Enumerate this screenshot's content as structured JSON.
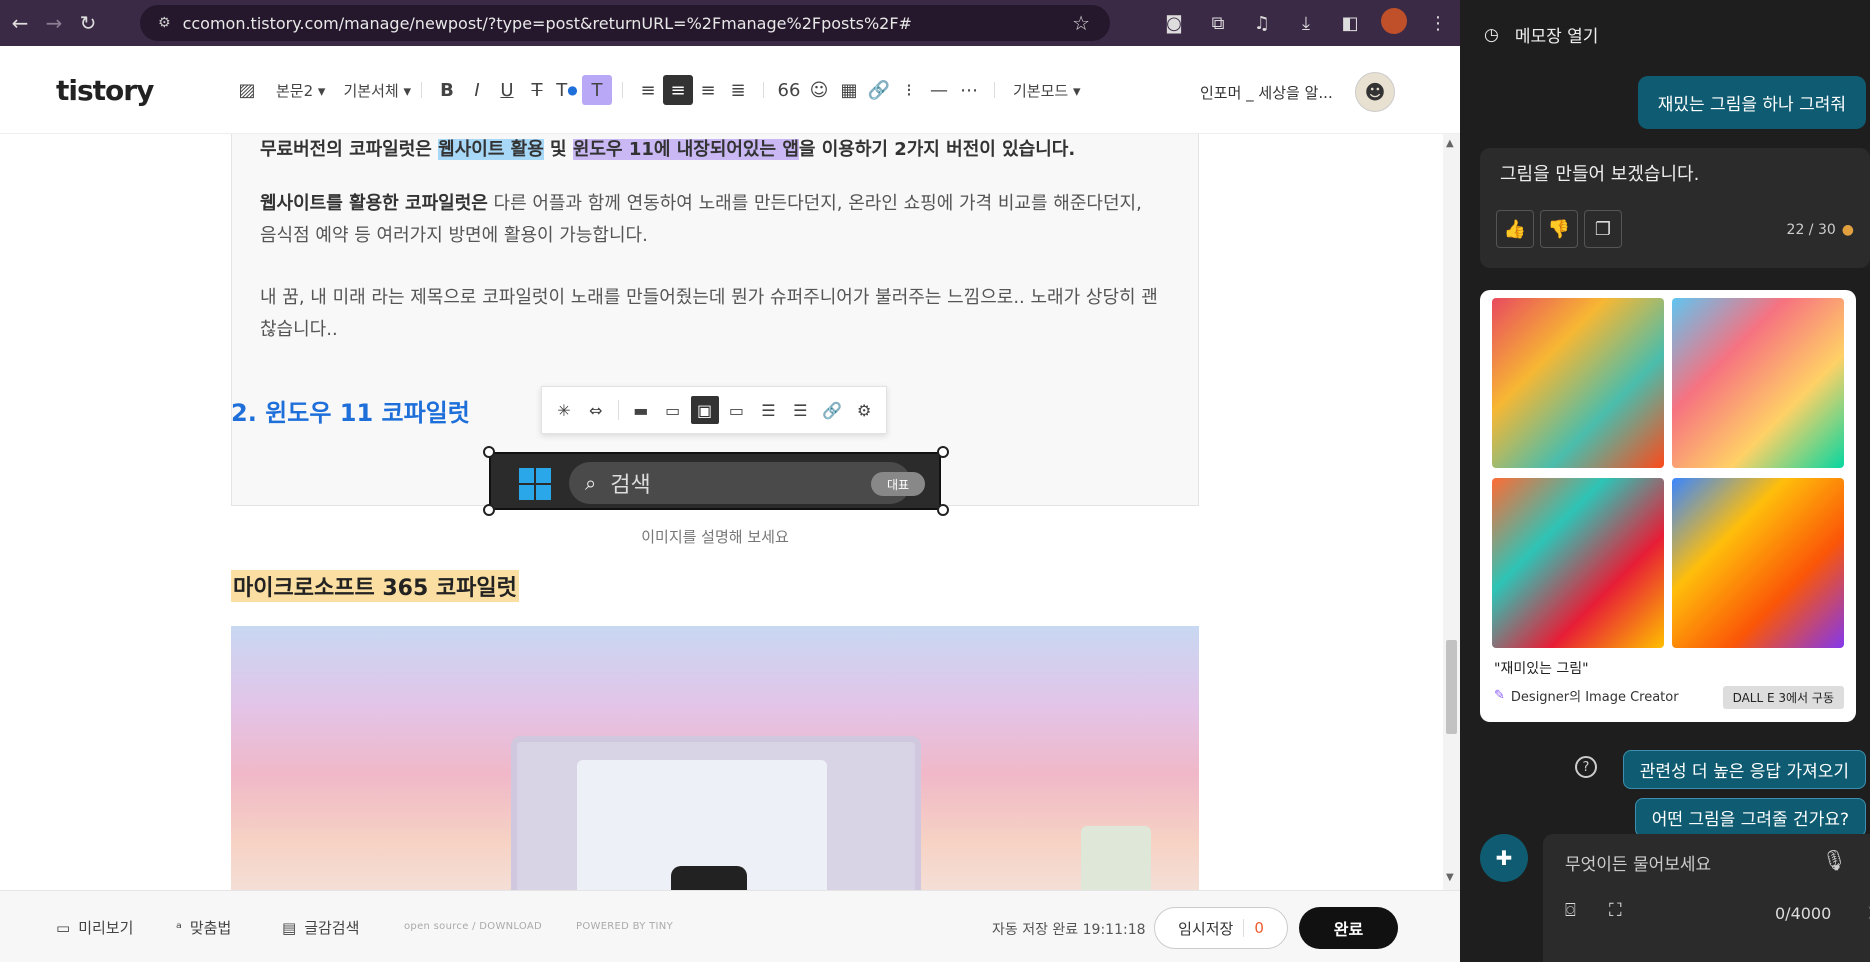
{
  "browser": {
    "url": "ccomon.tistory.com/manage/newpost/?type=post&returnURL=%2Fmanage%2Fposts%2F#"
  },
  "editor": {
    "logo": "tistory",
    "toolbar": {
      "paragraph_style": "본문2",
      "font": "기본서체",
      "mode": "기본모드"
    },
    "blog_name": "인포머 _ 세상을 알..."
  },
  "content": {
    "para1_part1": "무료버전의 코파일럿은 ",
    "para1_hl1": "웹사이트 활용",
    "para1_mid": " 및 ",
    "para1_hl2": "윈도우 11에 내장되어있는 앱",
    "para1_part2": "을 이용하기 2가지 버전이 있습니다.",
    "para2_bold": "웹사이트를 활용한 코파일럿은",
    "para2_rest": " 다른 어플과 함께 연동하여 노래를 만든다던지, 온라인 쇼핑에 가격 비교를 해준다던지, 음식점 예약 등 여러가지 방면에 활용이 가능합니다.",
    "para3": "내 꿈, 내 미래 라는 제목으로 코파일럿이 노래를 만들어줬는데 뭔가 슈퍼주니어가 불러주는 느낌으로.. 노래가 상당히 괜찮습니다..",
    "heading_copilot": "2. 윈도우 11 코파일럿",
    "taskbar_search": "검색",
    "taskbar_badge": "대표",
    "image_caption": "이미지를 설명해 보세요",
    "heading_m365": "마이크로소프트 365 코파일럿"
  },
  "bottom_bar": {
    "preview": "미리보기",
    "spellcheck": "맞춤법",
    "search_text": "글감검색",
    "open_source": "open source / DOWNLOAD",
    "powered": "POWERED BY TINY",
    "autosave": "자동 저장 완료 19:11:18",
    "temp_save": "임시저장",
    "temp_count": "0",
    "done": "완료"
  },
  "copilot": {
    "open_notepad": "메모장 열기",
    "user_msg": "재밌는 그림을 하나 그려줘",
    "ai_msg": "그림을 만들어 보겠습니다.",
    "turn_count": "22 / 30",
    "image_prompt": "\"재미있는 그림\"",
    "image_source": "Designer의 Image Creator",
    "image_badge": "DALL E 3에서 구동",
    "suggestion1": "관련성 더 높은 응답 가져오기",
    "suggestion2": "어떤 그림을 그려줄 건가요?",
    "input_placeholder": "무엇이든 물어보세요",
    "char_count": "0/4000"
  },
  "colors": {
    "heading_blue": "#1e6fd9",
    "highlight_yellow": "#fbdfa2",
    "copilot_teal": "#0f5c72",
    "chrome_purple": "#3b2a45"
  }
}
